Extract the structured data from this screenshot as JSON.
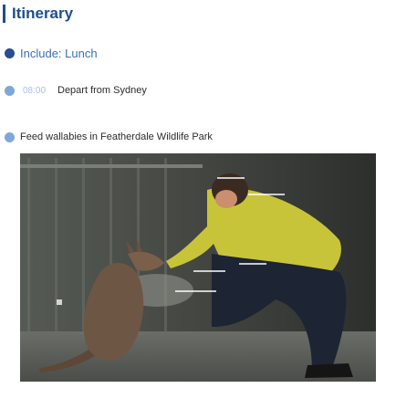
{
  "header": {
    "title": "Itinerary",
    "accent_color": "#1f4d8f"
  },
  "include": {
    "label": "Include: Lunch"
  },
  "items": [
    {
      "time": "08:00",
      "text": "Depart from Sydney"
    },
    {
      "text": "Feed wallabies in Featherdale Wildlife Park",
      "photo": "person-crouching-feeding-wallaby-photo"
    }
  ],
  "colors": {
    "dot_dark": "#274e8e",
    "dot_light": "#7fa8d9",
    "time": "#a9c1de"
  }
}
